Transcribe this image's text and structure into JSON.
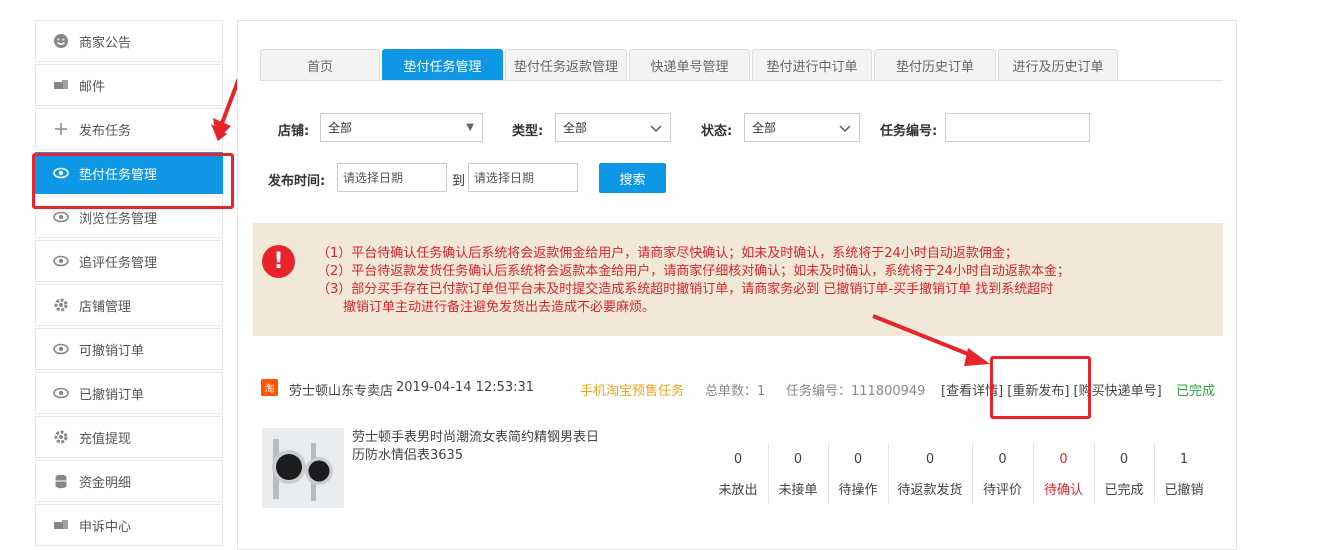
{
  "sidebar": {
    "items": [
      {
        "label": "商家公告",
        "icon": "smiley-icon"
      },
      {
        "label": "邮件",
        "icon": "mail-icon"
      },
      {
        "label": "发布任务",
        "icon": "plus-icon"
      },
      {
        "label": "垫付任务管理",
        "icon": "eye-icon",
        "active": true
      },
      {
        "label": "浏览任务管理",
        "icon": "eye-icon"
      },
      {
        "label": "追评任务管理",
        "icon": "eye-icon"
      },
      {
        "label": "店铺管理",
        "icon": "gear-icon"
      },
      {
        "label": "可撤销订单",
        "icon": "eye-icon"
      },
      {
        "label": "已撤销订单",
        "icon": "eye-icon"
      },
      {
        "label": "充值提现",
        "icon": "gear-icon"
      },
      {
        "label": "资金明细",
        "icon": "database-icon"
      },
      {
        "label": "申诉中心",
        "icon": "mail-icon"
      }
    ]
  },
  "tabs": [
    "首页",
    "垫付任务管理",
    "垫付任务返款管理",
    "快递单号管理",
    "垫付进行中订单",
    "垫付历史订单",
    "进行及历史订单"
  ],
  "filters": {
    "shop_label": "店铺:",
    "shop_value": "全部",
    "type_label": "类型:",
    "type_value": "全部",
    "status_label": "状态:",
    "status_value": "全部",
    "task_no_label": "任务编号:",
    "date_label": "发布时间:",
    "date_start_placeholder": "请选择日期",
    "date_to": "到",
    "date_end_placeholder": "请选择日期",
    "search_button": "搜索"
  },
  "notice": {
    "lines": [
      "（1）平台待确认任务确认后系统将会返款佣金给用户，请商家尽快确认；如未及时确认，系统将于24小时自动返款佣金；",
      "（2）平台待返款发货任务确认后系统将会返款本金给用户，请商家仔细核对确认；如未及时确认，系统将于24小时自动返款本金；",
      "（3）部分买手存在已付款订单但平台未及时提交造成系统超时撤销订单，请商家务必到 已撤销订单-买手撤销订单 找到系统超时",
      "　　撤销订单主动进行备注避免发货出去造成不必要麻烦。"
    ]
  },
  "order": {
    "platform_icon": "淘",
    "shop": "劳士顿山东专卖店",
    "time": "2019-04-14 12:53:31",
    "task_type": "手机淘宝预售任务",
    "total": "总单数：1",
    "task_no": "任务编号：111800949",
    "actions": "[查看详情] [重新发布] [购买快递单号]",
    "status": "已完成",
    "product_title": "劳士顿手表男时尚潮流女表简约精钢男表日历防水情侣表3635",
    "stats": [
      {
        "num": "0",
        "label": "未放出"
      },
      {
        "num": "0",
        "label": "未接单"
      },
      {
        "num": "0",
        "label": "待操作"
      },
      {
        "num": "0",
        "label": "待返款发货"
      },
      {
        "num": "0",
        "label": "待评价"
      },
      {
        "num": "0",
        "label": "待确认",
        "highlight": true
      },
      {
        "num": "0",
        "label": "已完成"
      },
      {
        "num": "1",
        "label": "已撤销"
      }
    ]
  },
  "colors": {
    "accent": "#0d97e5",
    "alert": "#e8232a",
    "gold": "#e6a817",
    "green": "#2aa53a"
  }
}
